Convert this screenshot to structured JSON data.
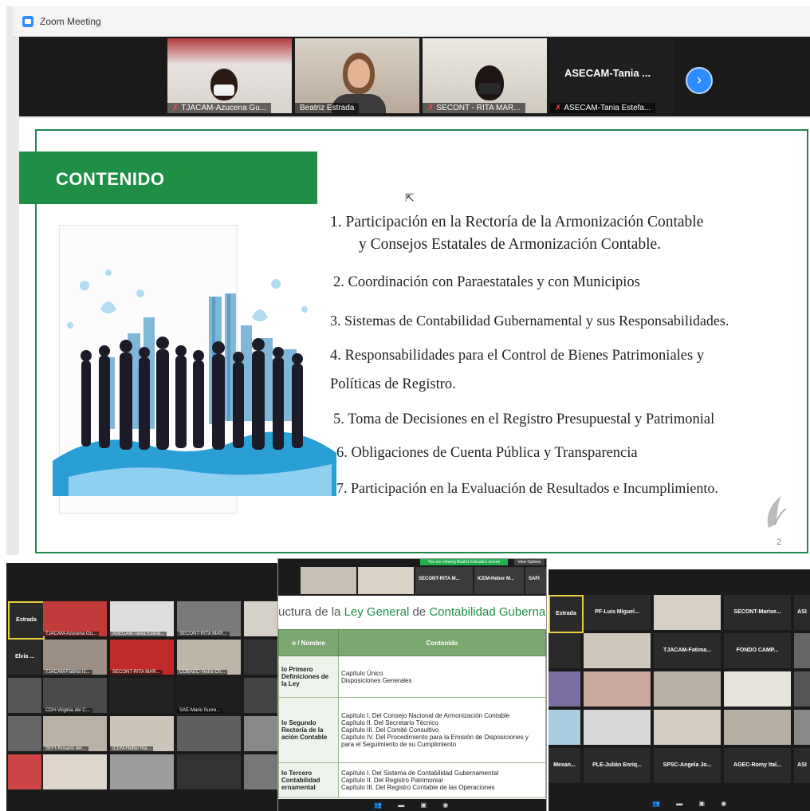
{
  "window": {
    "title": "Zoom Meeting"
  },
  "participants_strip": [
    {
      "name": "TJACAM-Azucena Gu..."
    },
    {
      "name": "Beatriz Estrada"
    },
    {
      "name": "SECONT - RITA MAR..."
    },
    {
      "name": "ASECAM-Tania Estefa...",
      "big_label": "ASECAM-Tania ..."
    }
  ],
  "slide": {
    "heading": "CONTENIDO",
    "items": [
      "1.  Participación en la Rectoría de la  Armonización Contable",
      "y  Consejos Estatales  de Armonización Contable.",
      "2. Coordinación con Paraestatales y con Municipios",
      "3. Sistemas de Contabilidad Gubernamental y sus Responsabilidades.",
      "4. Responsabilidades para el Control de Bienes Patrimoniales y",
      "Políticas de Registro.",
      "5. Toma de Decisiones en el Registro Presupuestal y Patrimonial",
      "6. Obligaciones de Cuenta Pública y Transparencia",
      "7. Participación en la Evaluación de Resultados  e Incumplimiento."
    ],
    "page_number": "2"
  },
  "left_gallery": {
    "names": [
      "Estrada",
      "Elvia ...",
      "TJACAM-Azucena Gu...",
      "ASECAM-Tania Estefa...",
      "SECONT-RITA MAR...",
      "TJACAM-Fatima Iz...",
      "COBAEC-Yedra Ch...",
      "CDH-Virginia del C...",
      "SAE-Mario Sucre...",
      "ICEM-Hebor Ma...",
      "SECONT-RITA MAR...",
      "SEFI-Rosario del..."
    ]
  },
  "doc_share": {
    "share_text": "You are viewing Beatriz Estrada's screen",
    "view_options": "View Options",
    "top_names": [
      "SECONT-RITA M...",
      "ICEM-Hebor M...",
      "SAFI"
    ],
    "title_prefix": "uctura de la ",
    "title_green_1": "Ley General",
    "title_mid": " de ",
    "title_green_2": "Contabilidad Gubername",
    "col_headers": [
      "o / Nombre",
      "Contenido"
    ],
    "rows": [
      {
        "c1": "lo Primero\nDefiniciones de la Ley",
        "c2": "Capítulo Único\nDisposiciones Generales"
      },
      {
        "c1": "lo Segundo\nRectoría de la\nación Contable",
        "c2": "Capítulo I. Del Consejo Nacional de Armonización Contable\nCapítulo II. Del Secretario Técnico\nCapítulo III. Del Comité Consultivo\nCapítulo IV. Del Procedimiento para la Emisión de Disposiciones y para el Seguimiento de su Cumplimiento"
      },
      {
        "c1": "lo Tercero\nContabilidad\nernamental",
        "c2": "Capítulo I. Del Sistema de Contabilidad Gubernamental\nCapítulo II. Del Registro Patrimonial\nCapítulo III. Del Registro Contable de las Operaciones"
      }
    ]
  },
  "right_gallery": {
    "names": [
      "Estrada",
      "PF-Luis Miguel...",
      "SECONT-Marise...",
      "ASI",
      "ASECAM-Tania T...",
      "TJACAM-Fatima...",
      "FONDO CAMP...",
      "Mexan...",
      "PLE-Julián Enriq...",
      "SPSC-Angela Jo...",
      "AGEC-Romy Ital...",
      "ASI"
    ]
  },
  "colors": {
    "slide_green": "#1f8f45",
    "zoom_blue": "#2d8cff",
    "table_header": "#7aa86e"
  }
}
